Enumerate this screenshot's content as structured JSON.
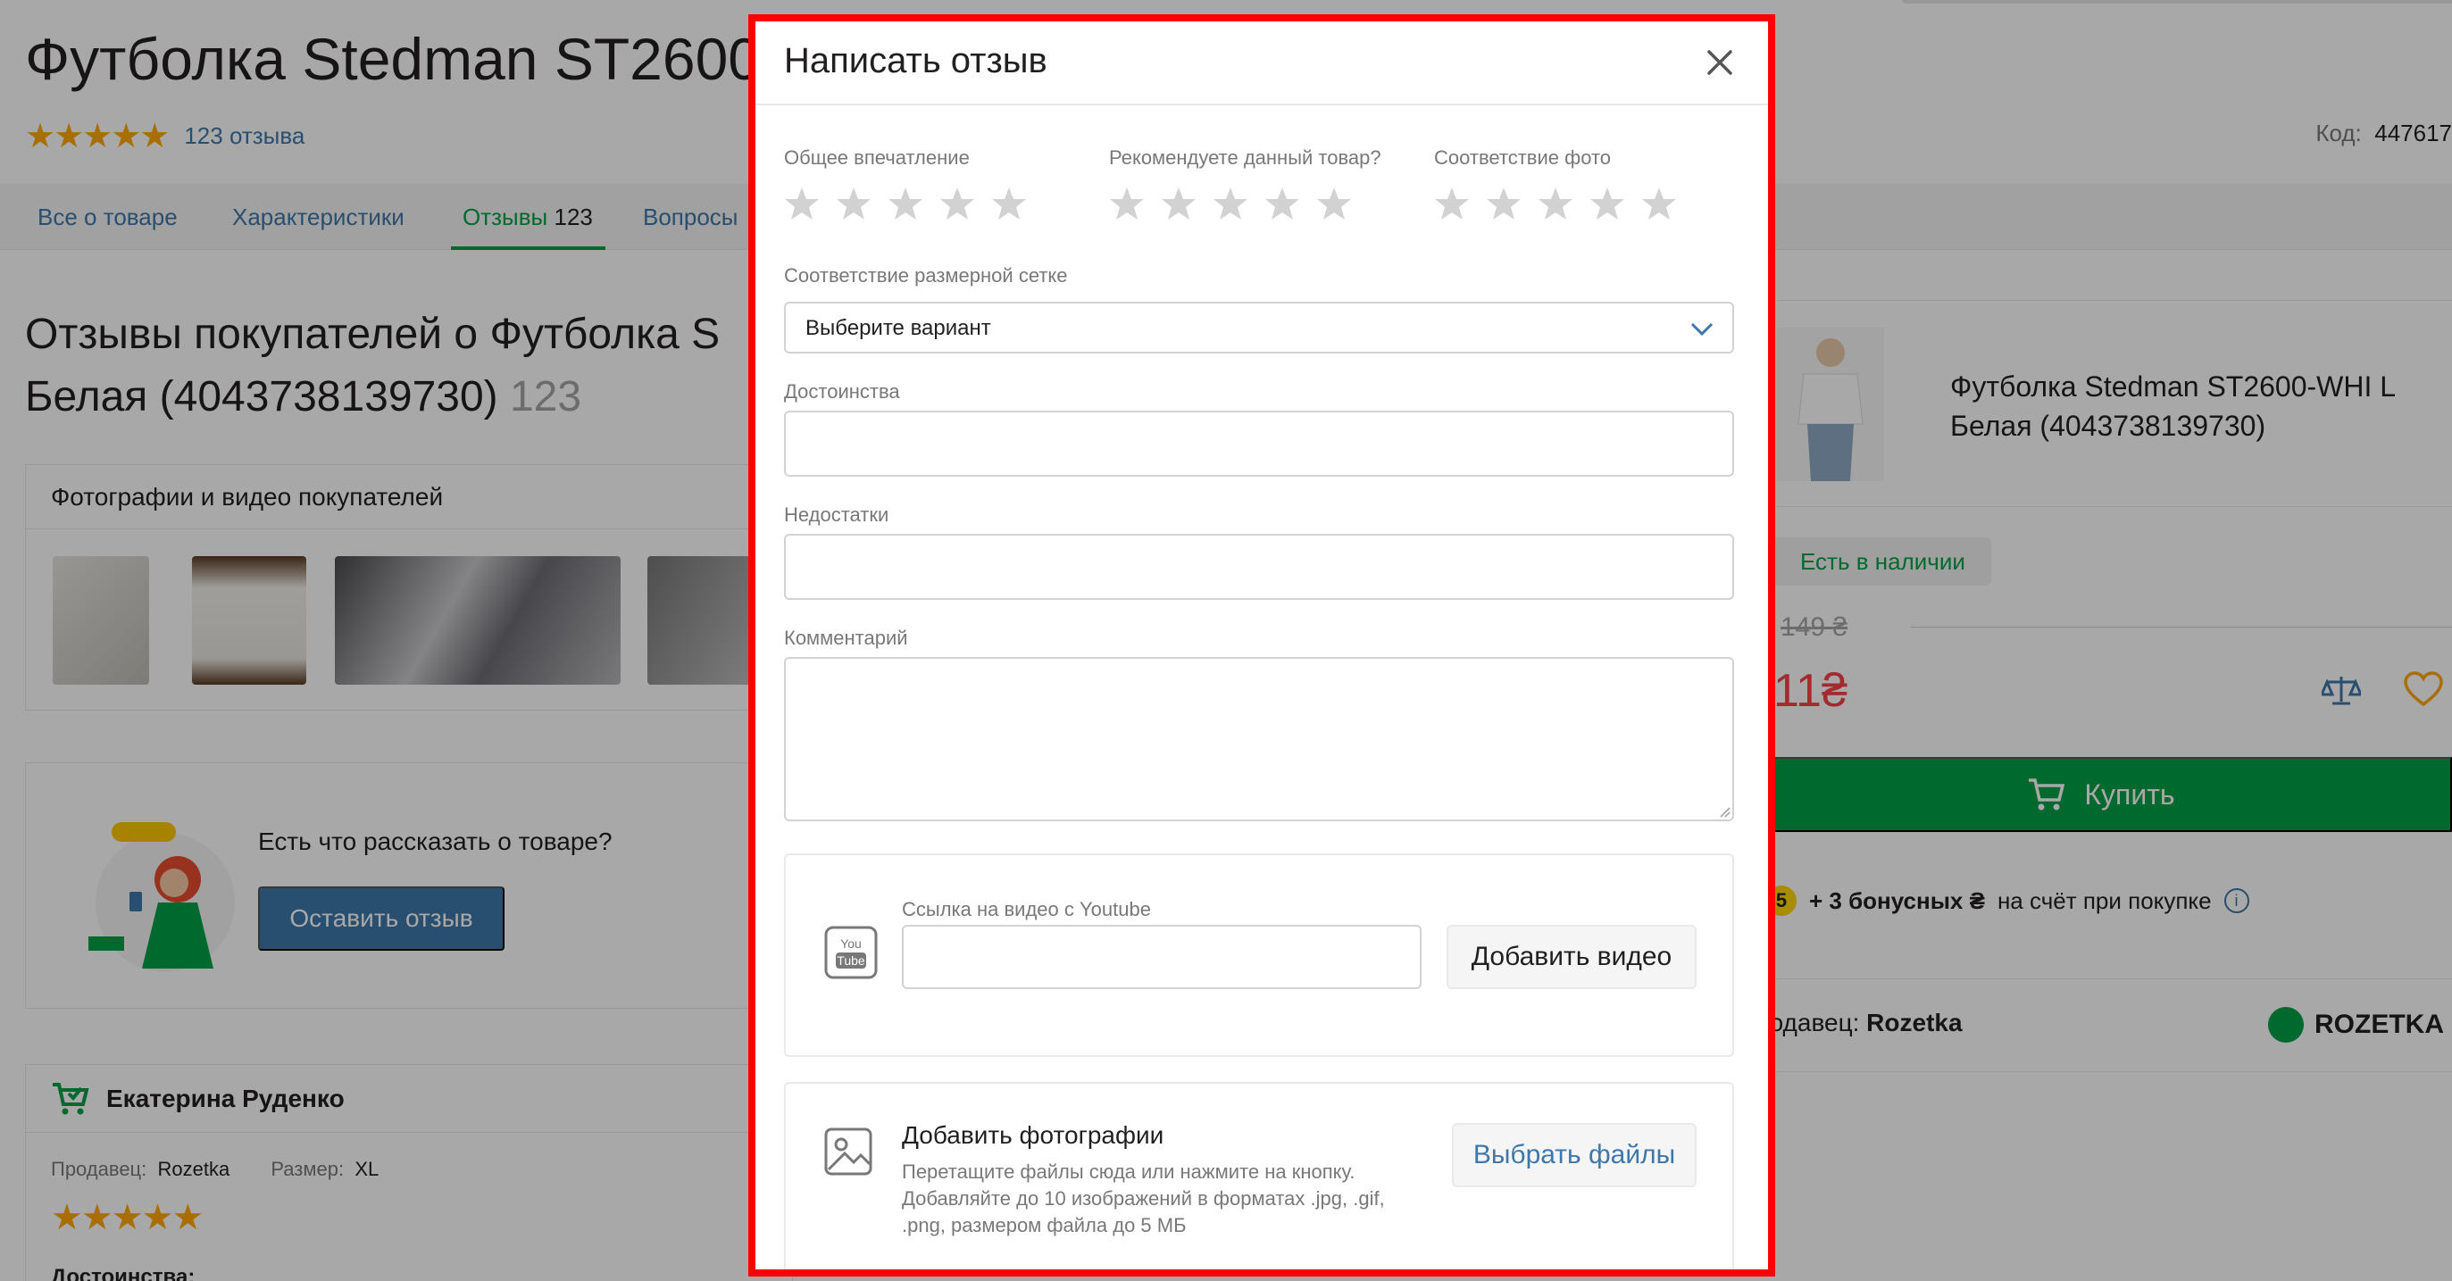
{
  "page": {
    "product_title": "Футболка Stedman ST2600",
    "reviews_link": "123 отзыва",
    "code_label": "Код:",
    "code_value": "447617",
    "tabs": [
      {
        "label": "Все о товаре"
      },
      {
        "label": "Характеристики"
      },
      {
        "label": "Отзывы",
        "count": "123"
      },
      {
        "label": "Вопросы"
      }
    ],
    "reviews_heading": "Отзывы покупателей о Футболка S",
    "reviews_heading_line2": "Белая (4043738139730)",
    "reviews_heading_count": "123",
    "photos_header": "Фотографии и видео покупателей",
    "tell_question": "Есть что рассказать о товаре?",
    "leave_review_button": "Оставить отзыв",
    "review": {
      "author": "Екатерина Руденко",
      "seller_label": "Продавец:",
      "seller_value": "Rozetka",
      "size_label": "Размер:",
      "size_value": "XL",
      "merits_label": "Достоинства:"
    },
    "sidebar": {
      "product_name_line1": "Футболка Stedman ST2600-WHI L",
      "product_name_line2": "Белая (4043738139730)",
      "stock": "Есть в наличии",
      "old_price": "149 ₴",
      "price": "11₴",
      "buy_button": "Купить",
      "bonus_coin": "5",
      "bonus_bold": "+ 3 бонусных ₴",
      "bonus_rest": "на счёт при покупке",
      "seller_label": "родавец:",
      "seller_value": "Rozetka",
      "logo_text": "ROZETKA"
    }
  },
  "modal": {
    "title": "Написать отзыв",
    "rating_groups": [
      {
        "label": "Общее впечатление"
      },
      {
        "label": "Рекомендуете данный товар?"
      },
      {
        "label": "Соответствие фото"
      }
    ],
    "size_label": "Соответствие размерной сетке",
    "size_selected": "Выберите вариант",
    "merits_label": "Достоинства",
    "merits_value": "",
    "flaws_label": "Недостатки",
    "flaws_value": "",
    "comment_label": "Комментарий",
    "comment_value": "",
    "video": {
      "label": "Ссылка на видео с Youtube",
      "value": "",
      "button": "Добавить видео",
      "icon_text_top": "You",
      "icon_text_bottom": "Tube"
    },
    "photos": {
      "title": "Добавить фотографии",
      "desc": "Перетащите файлы сюда или нажмите на кнопку. Добавляйте до 10 изображений в форматах .jpg, .gif, .png, размером файла до 5 МБ",
      "button": "Выбрать файлы"
    }
  },
  "colors": {
    "accent_green": "#00a046",
    "link_blue": "#3e77aa",
    "price_red": "#f84147",
    "star_gold": "#ffa900",
    "frame_red": "#ff0000"
  }
}
